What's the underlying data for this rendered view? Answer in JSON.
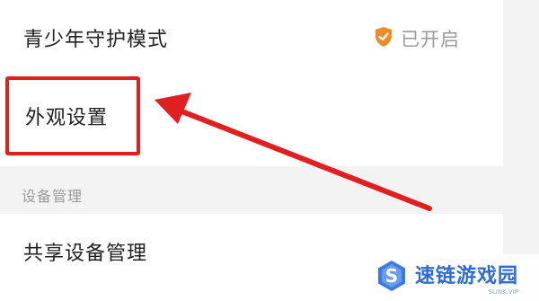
{
  "settings": {
    "teen_mode": {
      "label": "青少年守护模式",
      "status": "已开启",
      "icon": "shield-icon"
    },
    "appearance": {
      "label": "外观设置"
    },
    "section_header": "设备管理",
    "shared_devices": {
      "label": "共享设备管理"
    }
  },
  "annotation": {
    "color": "#e02020"
  },
  "watermark": {
    "name": "速链游戏园",
    "sub": "SLINK.VIP",
    "brand_color": "#2d6cd8"
  },
  "colors": {
    "shield": "#f08a24",
    "background": "#f3f3f3"
  }
}
